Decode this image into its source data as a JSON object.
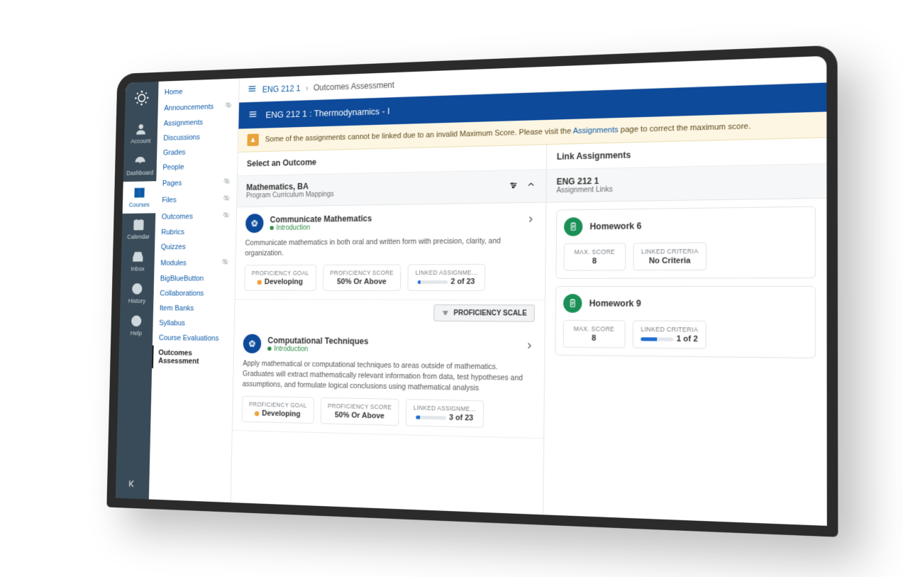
{
  "rail": {
    "items": [
      {
        "label": "Account"
      },
      {
        "label": "Dashboard"
      },
      {
        "label": "Courses"
      },
      {
        "label": "Calendar"
      },
      {
        "label": "Inbox"
      },
      {
        "label": "History"
      },
      {
        "label": "Help"
      }
    ]
  },
  "coursenav": {
    "items": [
      {
        "label": "Home",
        "hidden": false
      },
      {
        "label": "Announcements",
        "hidden": true
      },
      {
        "label": "Assignments",
        "hidden": false
      },
      {
        "label": "Discussions",
        "hidden": false
      },
      {
        "label": "Grades",
        "hidden": false
      },
      {
        "label": "People",
        "hidden": false
      },
      {
        "label": "Pages",
        "hidden": true
      },
      {
        "label": "Files",
        "hidden": true
      },
      {
        "label": "Outcomes",
        "hidden": true
      },
      {
        "label": "Rubrics",
        "hidden": false
      },
      {
        "label": "Quizzes",
        "hidden": false
      },
      {
        "label": "Modules",
        "hidden": true
      },
      {
        "label": "BigBlueButton",
        "hidden": false
      },
      {
        "label": "Collaborations",
        "hidden": false
      },
      {
        "label": "Item Banks",
        "hidden": false
      },
      {
        "label": "Syllabus",
        "hidden": false
      },
      {
        "label": "Course Evaluations",
        "hidden": false
      },
      {
        "label": "Outcomes Assessment",
        "hidden": false,
        "active": true
      }
    ]
  },
  "breadcrumb": {
    "course": "ENG 212 1",
    "page": "Outcomes Assessment"
  },
  "titlebar": {
    "text": "ENG 212 1 : Thermodynamics - I"
  },
  "alert": {
    "prefix": "Some of the assignments cannot be linked due to an invalid Maximum Score. Please visit the ",
    "link": "Assignments",
    "suffix": " page to correct the maximum score."
  },
  "left": {
    "header": "Select an Outcome",
    "program_title": "Mathematics, BA",
    "program_subtitle": "Program Curriculum Mappings",
    "outcomes": [
      {
        "title": "Communicate Mathematics",
        "tag": "Introduction",
        "desc": "Communicate mathematics in both oral and written form with precision, clarity, and organization.",
        "proficiency_goal": "Developing",
        "proficiency_score": "50% Or Above",
        "linked_text": "2 of 23",
        "linked_pct": 9
      },
      {
        "title": "Computational Techniques",
        "tag": "Introduction",
        "desc": "Apply mathematical or computational techniques to areas outside of mathematics. Graduates will extract mathematically relevant information from data, test hypotheses and assumptions, and formulate logical conclusions using mathematical analysis",
        "proficiency_goal": "Developing",
        "proficiency_score": "50% Or Above",
        "linked_text": "3 of 23",
        "linked_pct": 13
      }
    ],
    "prof_scale_btn": "PROFICIENCY SCALE",
    "stat_labels": {
      "goal": "PROFICIENCY GOAL",
      "score": "PROFICIENCY SCORE",
      "linked": "LINKED ASSIGNME…"
    }
  },
  "right": {
    "header": "Link Assignments",
    "course_code": "ENG 212 1",
    "course_sub": "Assignment Links",
    "stat_labels": {
      "max": "MAX. SCORE",
      "criteria": "LINKED CRITERIA"
    },
    "assignments": [
      {
        "title": "Homework 6",
        "max_score": "8",
        "criteria": "No Criteria",
        "criteria_pct": 0
      },
      {
        "title": "Homework 9",
        "max_score": "8",
        "criteria": "1 of 2",
        "criteria_pct": 50
      }
    ]
  }
}
